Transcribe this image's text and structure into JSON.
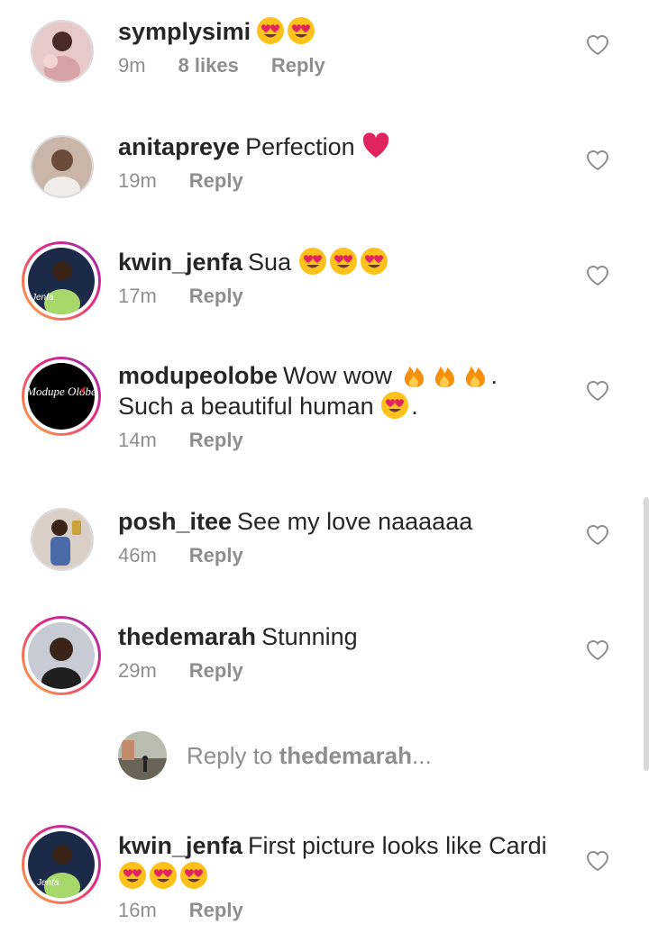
{
  "comments": [
    {
      "username": "symplysimi",
      "text": "",
      "emoji": [
        "heart-eyes",
        "heart-eyes"
      ],
      "time": "9m",
      "likes": "8 likes",
      "reply": "Reply",
      "avatar_ring": false
    },
    {
      "username": "anitapreye",
      "text": "Perfection",
      "emoji": [
        "red-heart"
      ],
      "time": "19m",
      "reply": "Reply",
      "avatar_ring": false
    },
    {
      "username": "kwin_jenfa",
      "text": "Sua",
      "emoji": [
        "heart-eyes",
        "heart-eyes",
        "heart-eyes"
      ],
      "time": "17m",
      "reply": "Reply",
      "avatar_ring": true,
      "avatar_label": "Jenfa"
    },
    {
      "username": "modupeolobe",
      "text": "Wow wow",
      "line2": "Such a beautiful human",
      "time": "14m",
      "reply": "Reply",
      "avatar_ring": true,
      "avatar_label": "Modupe Olobe"
    },
    {
      "username": "posh_itee",
      "text": "See my love naaaaaa",
      "time": "46m",
      "reply": "Reply",
      "avatar_ring": false
    },
    {
      "username": "thedemarah",
      "text": "Stunning",
      "time": "29m",
      "reply": "Reply",
      "avatar_ring": true
    },
    {
      "username": "kwin_jenfa",
      "text": "First picture looks like Cardi",
      "time": "16m",
      "reply": "Reply",
      "avatar_ring": true,
      "avatar_label": "Jenfa"
    }
  ],
  "reply_prompt": {
    "prefix": "Reply to",
    "username": "thedemarah",
    "suffix": "..."
  },
  "colors": {
    "username": "#262626",
    "meta": "#8e8e8e",
    "ring_start": "#f7b33b",
    "ring_end": "#8b2fb4",
    "heart_red": "#e0245e"
  }
}
